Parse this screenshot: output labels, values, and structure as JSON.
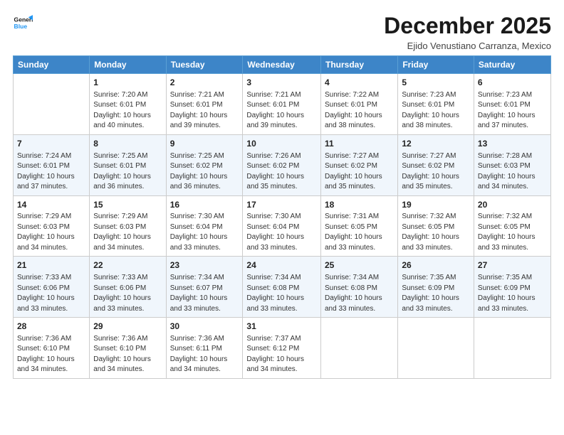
{
  "logo": {
    "line1": "General",
    "line2": "Blue"
  },
  "title": "December 2025",
  "location": "Ejido Venustiano Carranza, Mexico",
  "days_of_week": [
    "Sunday",
    "Monday",
    "Tuesday",
    "Wednesday",
    "Thursday",
    "Friday",
    "Saturday"
  ],
  "weeks": [
    [
      {
        "day": "",
        "info": ""
      },
      {
        "day": "1",
        "info": "Sunrise: 7:20 AM\nSunset: 6:01 PM\nDaylight: 10 hours\nand 40 minutes."
      },
      {
        "day": "2",
        "info": "Sunrise: 7:21 AM\nSunset: 6:01 PM\nDaylight: 10 hours\nand 39 minutes."
      },
      {
        "day": "3",
        "info": "Sunrise: 7:21 AM\nSunset: 6:01 PM\nDaylight: 10 hours\nand 39 minutes."
      },
      {
        "day": "4",
        "info": "Sunrise: 7:22 AM\nSunset: 6:01 PM\nDaylight: 10 hours\nand 38 minutes."
      },
      {
        "day": "5",
        "info": "Sunrise: 7:23 AM\nSunset: 6:01 PM\nDaylight: 10 hours\nand 38 minutes."
      },
      {
        "day": "6",
        "info": "Sunrise: 7:23 AM\nSunset: 6:01 PM\nDaylight: 10 hours\nand 37 minutes."
      }
    ],
    [
      {
        "day": "7",
        "info": "Sunrise: 7:24 AM\nSunset: 6:01 PM\nDaylight: 10 hours\nand 37 minutes."
      },
      {
        "day": "8",
        "info": "Sunrise: 7:25 AM\nSunset: 6:01 PM\nDaylight: 10 hours\nand 36 minutes."
      },
      {
        "day": "9",
        "info": "Sunrise: 7:25 AM\nSunset: 6:02 PM\nDaylight: 10 hours\nand 36 minutes."
      },
      {
        "day": "10",
        "info": "Sunrise: 7:26 AM\nSunset: 6:02 PM\nDaylight: 10 hours\nand 35 minutes."
      },
      {
        "day": "11",
        "info": "Sunrise: 7:27 AM\nSunset: 6:02 PM\nDaylight: 10 hours\nand 35 minutes."
      },
      {
        "day": "12",
        "info": "Sunrise: 7:27 AM\nSunset: 6:02 PM\nDaylight: 10 hours\nand 35 minutes."
      },
      {
        "day": "13",
        "info": "Sunrise: 7:28 AM\nSunset: 6:03 PM\nDaylight: 10 hours\nand 34 minutes."
      }
    ],
    [
      {
        "day": "14",
        "info": "Sunrise: 7:29 AM\nSunset: 6:03 PM\nDaylight: 10 hours\nand 34 minutes."
      },
      {
        "day": "15",
        "info": "Sunrise: 7:29 AM\nSunset: 6:03 PM\nDaylight: 10 hours\nand 34 minutes."
      },
      {
        "day": "16",
        "info": "Sunrise: 7:30 AM\nSunset: 6:04 PM\nDaylight: 10 hours\nand 33 minutes."
      },
      {
        "day": "17",
        "info": "Sunrise: 7:30 AM\nSunset: 6:04 PM\nDaylight: 10 hours\nand 33 minutes."
      },
      {
        "day": "18",
        "info": "Sunrise: 7:31 AM\nSunset: 6:05 PM\nDaylight: 10 hours\nand 33 minutes."
      },
      {
        "day": "19",
        "info": "Sunrise: 7:32 AM\nSunset: 6:05 PM\nDaylight: 10 hours\nand 33 minutes."
      },
      {
        "day": "20",
        "info": "Sunrise: 7:32 AM\nSunset: 6:05 PM\nDaylight: 10 hours\nand 33 minutes."
      }
    ],
    [
      {
        "day": "21",
        "info": "Sunrise: 7:33 AM\nSunset: 6:06 PM\nDaylight: 10 hours\nand 33 minutes."
      },
      {
        "day": "22",
        "info": "Sunrise: 7:33 AM\nSunset: 6:06 PM\nDaylight: 10 hours\nand 33 minutes."
      },
      {
        "day": "23",
        "info": "Sunrise: 7:34 AM\nSunset: 6:07 PM\nDaylight: 10 hours\nand 33 minutes."
      },
      {
        "day": "24",
        "info": "Sunrise: 7:34 AM\nSunset: 6:08 PM\nDaylight: 10 hours\nand 33 minutes."
      },
      {
        "day": "25",
        "info": "Sunrise: 7:34 AM\nSunset: 6:08 PM\nDaylight: 10 hours\nand 33 minutes."
      },
      {
        "day": "26",
        "info": "Sunrise: 7:35 AM\nSunset: 6:09 PM\nDaylight: 10 hours\nand 33 minutes."
      },
      {
        "day": "27",
        "info": "Sunrise: 7:35 AM\nSunset: 6:09 PM\nDaylight: 10 hours\nand 33 minutes."
      }
    ],
    [
      {
        "day": "28",
        "info": "Sunrise: 7:36 AM\nSunset: 6:10 PM\nDaylight: 10 hours\nand 34 minutes."
      },
      {
        "day": "29",
        "info": "Sunrise: 7:36 AM\nSunset: 6:10 PM\nDaylight: 10 hours\nand 34 minutes."
      },
      {
        "day": "30",
        "info": "Sunrise: 7:36 AM\nSunset: 6:11 PM\nDaylight: 10 hours\nand 34 minutes."
      },
      {
        "day": "31",
        "info": "Sunrise: 7:37 AM\nSunset: 6:12 PM\nDaylight: 10 hours\nand 34 minutes."
      },
      {
        "day": "",
        "info": ""
      },
      {
        "day": "",
        "info": ""
      },
      {
        "day": "",
        "info": ""
      }
    ]
  ]
}
